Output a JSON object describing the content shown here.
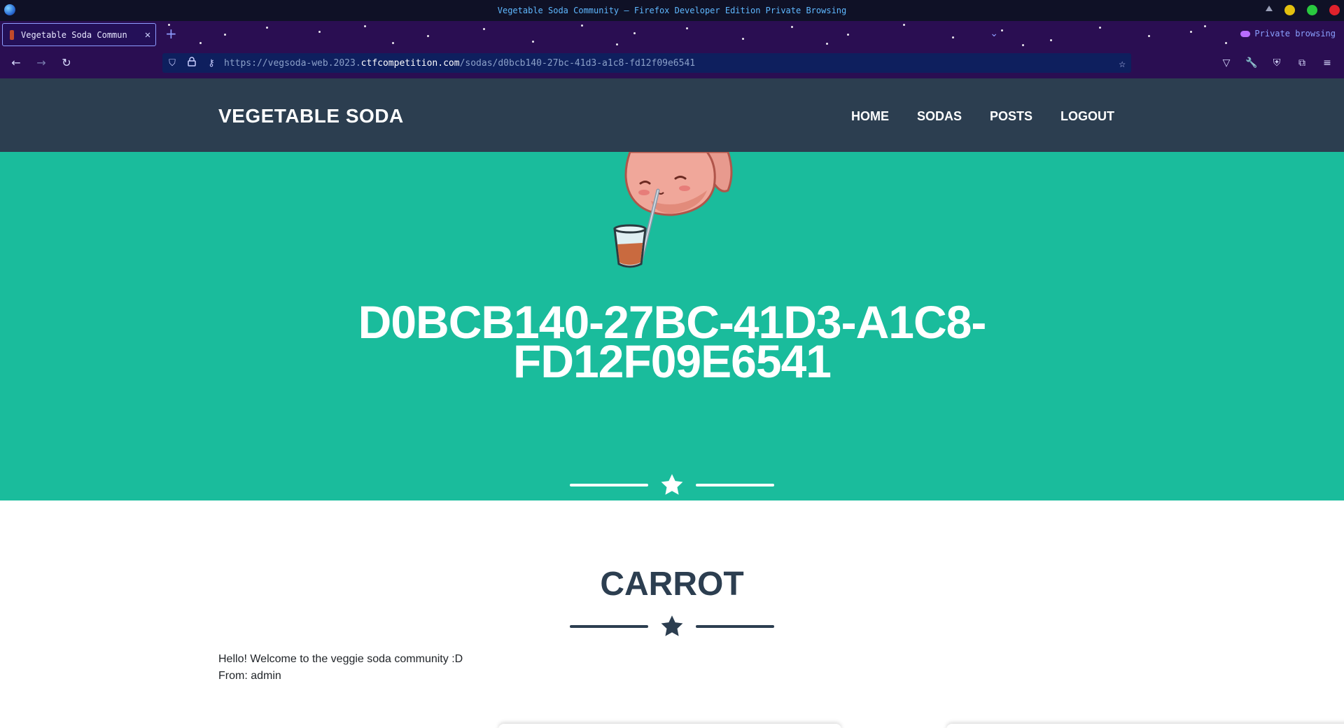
{
  "window": {
    "title": "Vegetable Soda Community — Firefox Developer Edition Private Browsing"
  },
  "tabs": [
    {
      "title": "Vegetable Soda Commun",
      "active": true
    }
  ],
  "toolbar": {
    "private_label": "Private browsing",
    "url_prefix": "https://vegsoda-web.2023.",
    "url_host": "ctfcompetition.com",
    "url_path": "/sodas/d0bcb140-27bc-41d3-a1c8-fd12f09e6541"
  },
  "site": {
    "brand": "VEGETABLE SODA",
    "menu": [
      "HOME",
      "SODAS",
      "POSTS",
      "LOGOUT"
    ]
  },
  "masthead": {
    "title_line1": "D0BCB140-27BC-41D3-A1C8-",
    "title_line2": "FD12F09E6541",
    "background": "#1abc9c"
  },
  "section": {
    "title": "CARROT",
    "message": "Hello! Welcome to the veggie soda community :D",
    "from": "From: admin"
  },
  "colors": {
    "navbar": "#2c3e50",
    "accent": "#1abc9c",
    "chrome": "#2a0e52"
  }
}
